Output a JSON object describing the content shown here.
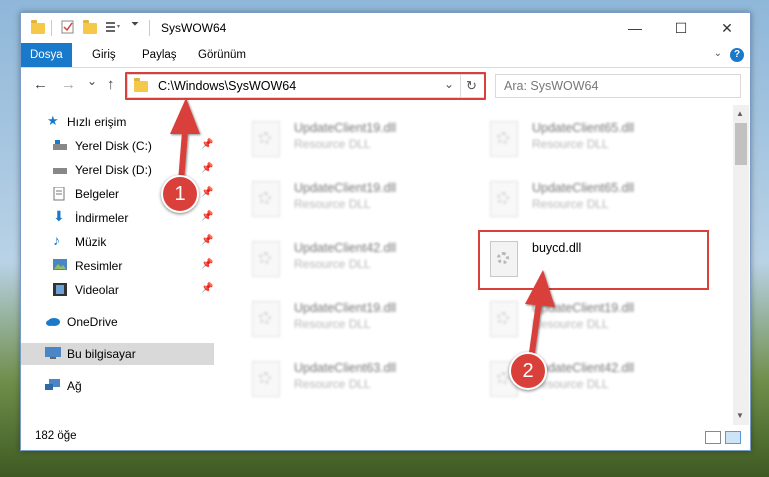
{
  "window": {
    "title": "SysWOW64",
    "minimize": "—",
    "maximize": "☐",
    "close": "✕"
  },
  "ribbon": {
    "tabs": [
      "Dosya",
      "Giriş",
      "Paylaş",
      "Görünüm"
    ],
    "help": "?"
  },
  "nav": {
    "back": "←",
    "forward": "→",
    "recent": "⌄",
    "up": "↑",
    "address": "C:\\Windows\\SysWOW64",
    "dropdown": "⌄",
    "refresh": "↻",
    "search_placeholder": "Ara: SysWOW64"
  },
  "sidebar": {
    "items": [
      {
        "label": "Hızlı erişim",
        "icon": "star-icon",
        "pinned": false
      },
      {
        "label": "Yerel Disk (C:)",
        "icon": "drive-icon",
        "pinned": true
      },
      {
        "label": "Yerel Disk (D:)",
        "icon": "drive-icon",
        "pinned": true
      },
      {
        "label": "Belgeler",
        "icon": "documents-icon",
        "pinned": true
      },
      {
        "label": "İndirmeler",
        "icon": "download-icon",
        "pinned": true
      },
      {
        "label": "Müzik",
        "icon": "music-icon",
        "pinned": true
      },
      {
        "label": "Resimler",
        "icon": "pictures-icon",
        "pinned": true
      },
      {
        "label": "Videolar",
        "icon": "videos-icon",
        "pinned": true
      },
      {
        "label": "OneDrive",
        "icon": "cloud-icon",
        "pinned": false
      },
      {
        "label": "Bu bilgisayar",
        "icon": "computer-icon",
        "pinned": false,
        "selected": true
      },
      {
        "label": "Ağ",
        "icon": "network-icon",
        "pinned": false
      }
    ]
  },
  "files": [
    {
      "name": "UpdateClient19.dll",
      "desc": "Resource DLL",
      "faded": true
    },
    {
      "name": "UpdateClient65.dll",
      "desc": "Resource DLL",
      "faded": true
    },
    {
      "name": "UpdateClient19.dll",
      "desc": "Resource DLL",
      "faded": true
    },
    {
      "name": "UpdateClient65.dll",
      "desc": "Resource DLL",
      "faded": true
    },
    {
      "name": "UpdateClient42.dll",
      "desc": "Resource DLL",
      "faded": true
    },
    {
      "name": "buycd.dll",
      "desc": "",
      "faded": false
    },
    {
      "name": "UpdateClient19.dll",
      "desc": "Resource DLL",
      "faded": true
    },
    {
      "name": "UpdateClient19.dll",
      "desc": "Resource DLL",
      "faded": true
    },
    {
      "name": "UpdateClient63.dll",
      "desc": "Resource DLL",
      "faded": true
    },
    {
      "name": "UpdateClient42.dll",
      "desc": "Resource DLL",
      "faded": true
    }
  ],
  "status": {
    "count": "182 öğe"
  },
  "annotations": {
    "step1": "1",
    "step2": "2",
    "color": "#d9403a"
  }
}
